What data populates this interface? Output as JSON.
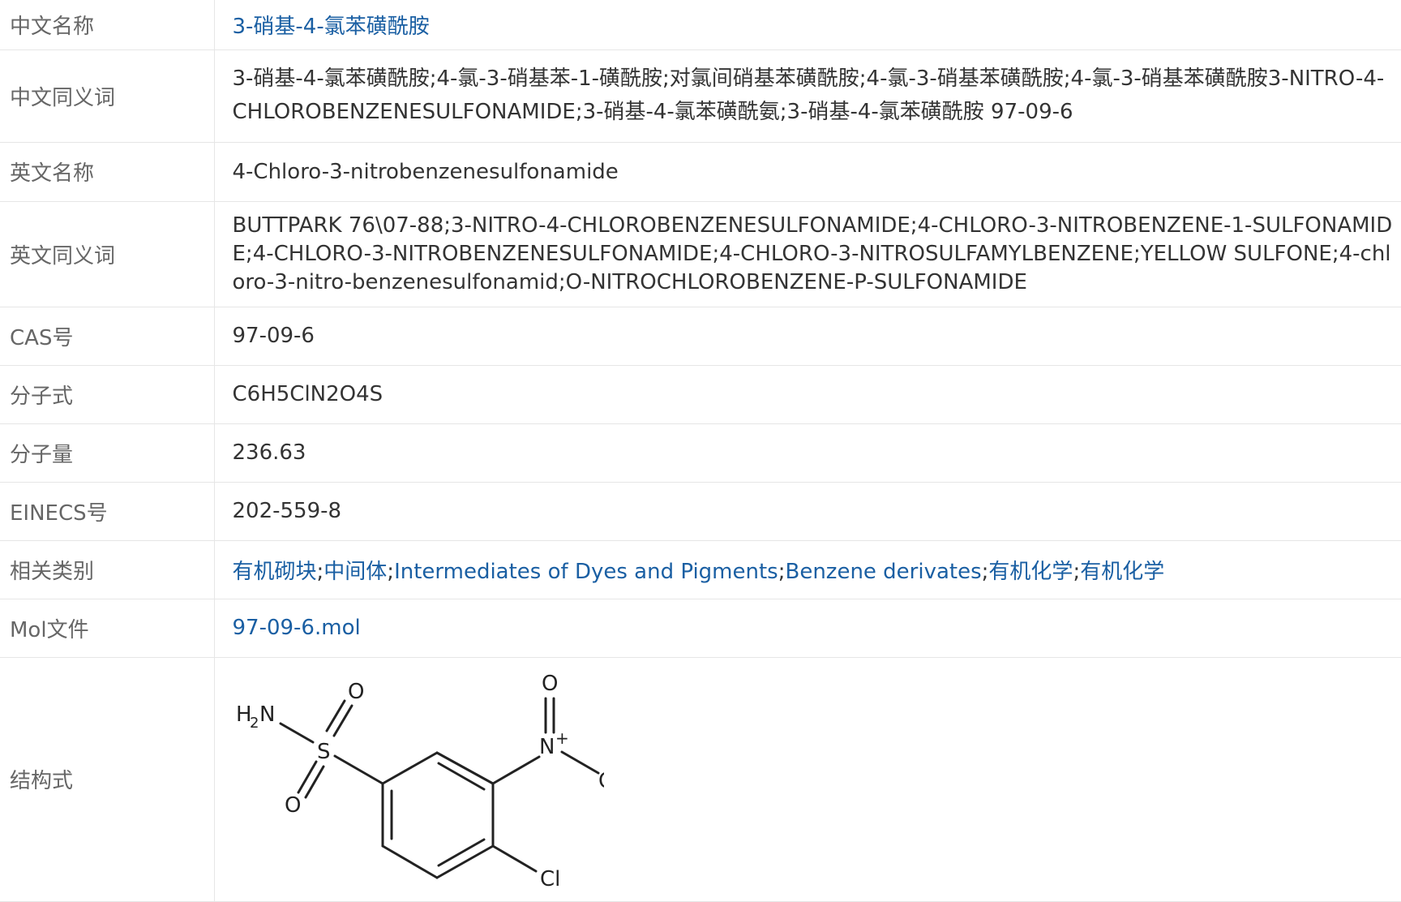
{
  "rows": {
    "cn_name": {
      "label": "中文名称",
      "value": "3-硝基-4-氯苯磺酰胺"
    },
    "cn_synonyms": {
      "label": "中文同义词",
      "value": "3-硝基-4-氯苯磺酰胺;4-氯-3-硝基苯-1-磺酰胺;对氯间硝基苯磺酰胺;4-氯-3-硝基苯磺酰胺;4-氯-3-硝基苯磺酰胺3-NITRO-4-CHLOROBENZENESULFONAMIDE;3-硝基-4-氯苯磺酰氨;3-硝基-4-氯苯磺酰胺 97-09-6"
    },
    "en_name": {
      "label": "英文名称",
      "value": "4-Chloro-3-nitrobenzenesulfonamide"
    },
    "en_synonyms": {
      "label": "英文同义词",
      "value": "BUTTPARK 76\\07-88;3-NITRO-4-CHLOROBENZENESULFONAMIDE;4-CHLORO-3-NITROBENZENE-1-SULFONAMIDE;4-CHLORO-3-NITROBENZENESULFONAMIDE;4-CHLORO-3-NITROSULFAMYLBENZENE;YELLOW SULFONE;4-chloro-3-nitro-benzenesulfonamid;O-NITROCHLOROBENZENE-P-SULFONAMIDE"
    },
    "cas": {
      "label": "CAS号",
      "value": "97-09-6"
    },
    "formula": {
      "label": "分子式",
      "value": "C6H5ClN2O4S"
    },
    "mw": {
      "label": "分子量",
      "value": "236.63"
    },
    "einecs": {
      "label": "EINECS号",
      "value": "202-559-8"
    },
    "categories": {
      "label": "相关类别",
      "links": [
        "有机砌块",
        "中间体",
        "Intermediates of Dyes and Pigments",
        "Benzene derivates",
        "有机化学",
        "有机化学"
      ],
      "separator": ";"
    },
    "mol_file": {
      "label": "Mol文件",
      "value": "97-09-6.mol"
    },
    "structure": {
      "label": "结构式",
      "atoms": {
        "nh2_h": "H",
        "nh2_sub": "2",
        "nh2_n": "N",
        "s": "S",
        "o_top": "O",
        "o_bottom": "O",
        "o_nitro_top": "O",
        "n_nitro": "N",
        "n_charge": "+",
        "o_minus": "O",
        "o_charge": "-",
        "cl": "Cl"
      }
    }
  },
  "colors": {
    "link": "#1a5fa3",
    "border": "#e6e6e6",
    "label_text": "#666666",
    "value_text": "#333333"
  }
}
